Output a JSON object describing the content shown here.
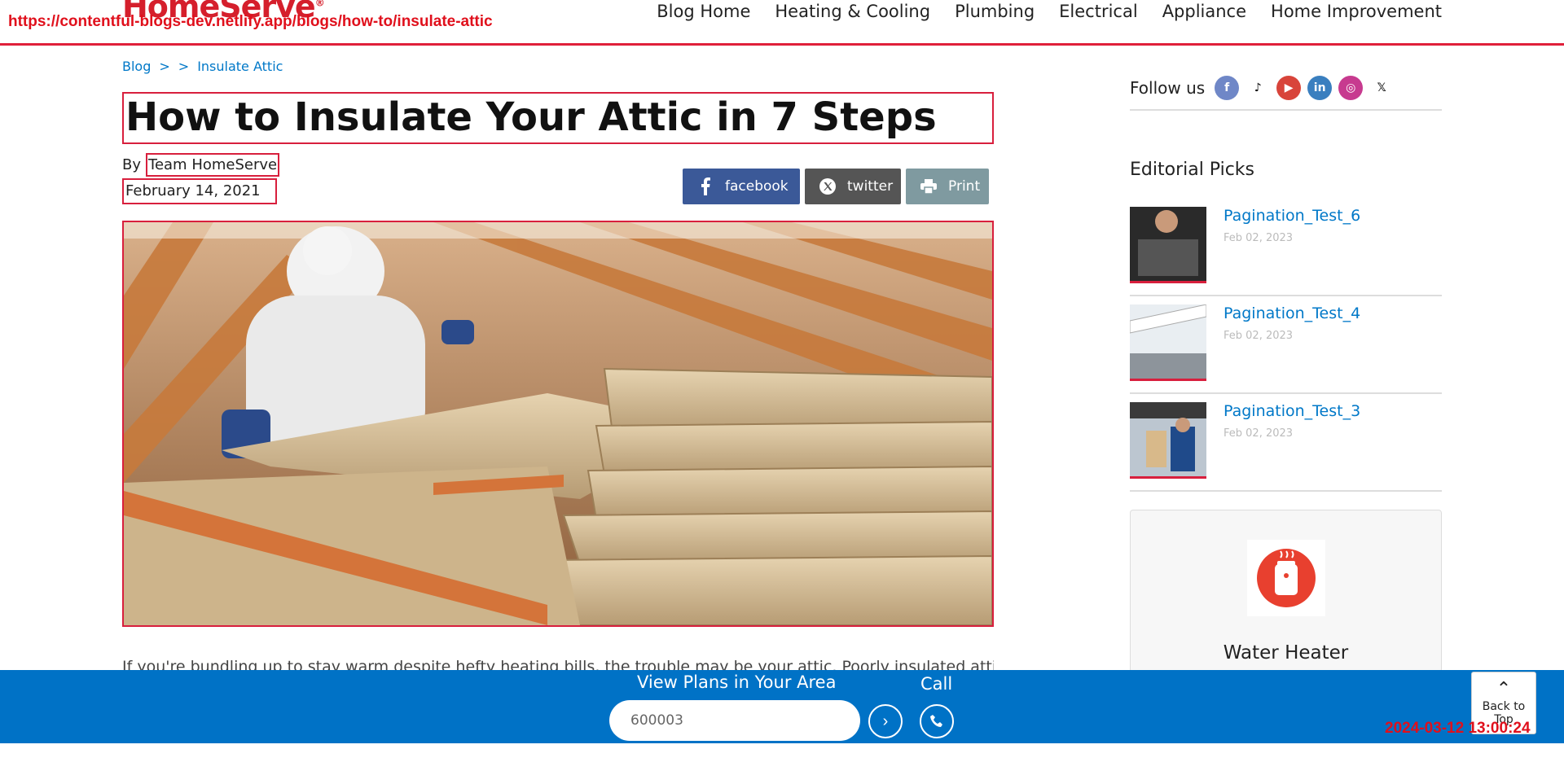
{
  "header": {
    "logo_text": "HomeServe",
    "url_overlay": "https://contentful-blogs-dev.netlify.app/blogs/how-to/insulate-attic",
    "nav": [
      "Blog Home",
      "Heating & Cooling",
      "Plumbing",
      "Electrical",
      "Appliance",
      "Home Improvement"
    ]
  },
  "breadcrumb": {
    "items": [
      "Blog",
      ">",
      ">",
      "Insulate Attic"
    ]
  },
  "article": {
    "title": "How to Insulate Your Attic in 7 Steps",
    "by_label": "By",
    "author": "Team HomeServe",
    "date": "February 14, 2021",
    "intro": "If you're bundling up to stay warm despite hefty heating bills, the trouble may be your attic. Poorly insulated attics can"
  },
  "share": {
    "facebook": "facebook",
    "twitter": "twitter",
    "print": "Print"
  },
  "sidebar": {
    "follow_label": "Follow us",
    "social_icons": [
      "facebook-icon",
      "tiktok-icon",
      "youtube-icon",
      "linkedin-icon",
      "instagram-icon",
      "x-icon"
    ],
    "editorial_title": "Editorial Picks",
    "picks": [
      {
        "title": "Pagination_Test_6",
        "date": "Feb 02, 2023"
      },
      {
        "title": "Pagination_Test_4",
        "date": "Feb 02, 2023"
      },
      {
        "title": "Pagination_Test_3",
        "date": "Feb 02, 2023"
      }
    ],
    "card_title": "Water Heater"
  },
  "bottom_bar": {
    "plans_label": "View Plans in Your Area",
    "zip_value": "600003",
    "call_label": "Call"
  },
  "back_to_top": "Back to Top",
  "timestamp": "2024-03-12 13:00:24",
  "colors": {
    "brand_red": "#d51f2c",
    "link_blue": "#0078c8",
    "bar_blue": "#0072c6",
    "facebook": "#3b5998"
  }
}
